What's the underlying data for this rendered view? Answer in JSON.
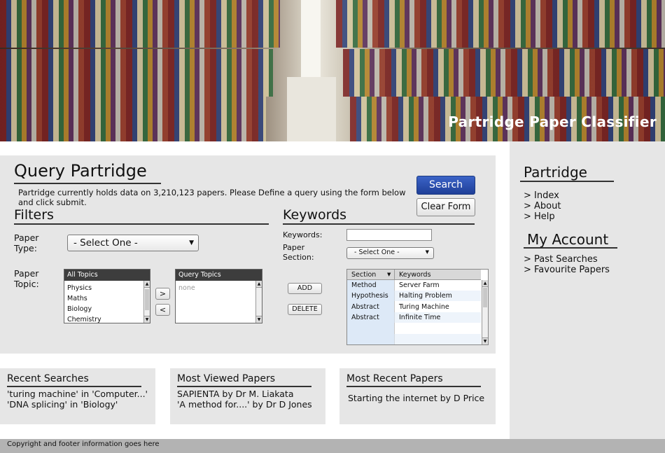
{
  "banner": {
    "title": "Partridge Paper Classifier"
  },
  "query": {
    "title": "Query Partridge",
    "intro": "Partridge currently holds data on 3,210,123 papers. Please Define a query  using the form  below and click submit.",
    "search_button": "Search",
    "clear_button": "Clear Form"
  },
  "filters": {
    "title": "Filters",
    "paper_type_label": "Paper\nType:",
    "paper_type_value": "- Select One -",
    "paper_topic_label": "Paper\nTopic:",
    "all_topics": {
      "header": "All Topics",
      "items": [
        "Physics",
        "Maths",
        "Biology",
        "Chemistry"
      ]
    },
    "move_right": ">",
    "move_left": "<",
    "query_topics": {
      "header": "Query Topics",
      "items": [
        "none"
      ]
    }
  },
  "keywords": {
    "title": "Keywords",
    "keywords_label": "Keywords:",
    "keywords_value": "",
    "section_label": "Paper\nSection:",
    "section_value": "- Select One -",
    "add_button": "ADD",
    "delete_button": "DELETE",
    "grid": {
      "columns": [
        "Section",
        "Keywords"
      ],
      "rows": [
        {
          "section": "Method",
          "keyword": "Server Farm"
        },
        {
          "section": "Hypothesis",
          "keyword": "Halting Problem"
        },
        {
          "section": "Abstract",
          "keyword": "Turing Machine"
        },
        {
          "section": "Abstract",
          "keyword": "Infinite Time"
        }
      ]
    }
  },
  "sidebar": {
    "partridge_title": "Partridge",
    "links": [
      "> Index",
      "> About",
      "> Help"
    ],
    "account_title": "My Account",
    "account_links": [
      "> Past Searches",
      "> Favourite Papers"
    ]
  },
  "recent_searches": {
    "title": "Recent Searches",
    "items": [
      "'turing machine' in 'Computer...'",
      "'DNA splicing' in 'Biology'"
    ]
  },
  "most_viewed": {
    "title": "Most Viewed Papers",
    "items": [
      "SAPIENTA by Dr M. Liakata",
      "'A method for....' by Dr D Jones"
    ]
  },
  "most_recent": {
    "title": "Most Recent Papers",
    "items": [
      "Starting the internet by D Price"
    ]
  },
  "footer": {
    "text": "Copyright and footer information goes here"
  }
}
